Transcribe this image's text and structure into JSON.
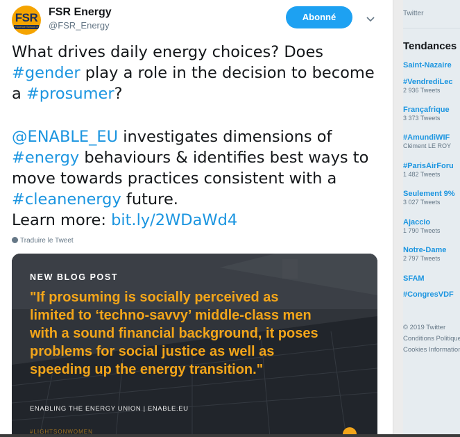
{
  "tweet": {
    "author_name": "FSR Energy",
    "author_handle": "@FSR_Energy",
    "avatar_text": "FSR",
    "avatar_subtext": "Florence School of Regulation",
    "follow_label": "Abonné",
    "paragraph1": [
      {
        "text": "What drives daily energy choices? Does ",
        "link": false
      },
      {
        "text": "#gender",
        "link": true
      },
      {
        "text": " play a role in the decision to become a ",
        "link": false
      },
      {
        "text": "#prosumer",
        "link": true
      },
      {
        "text": "?",
        "link": false
      }
    ],
    "paragraph2": [
      {
        "text": "@ENABLE_EU",
        "link": true
      },
      {
        "text": " investigates dimensions of ",
        "link": false
      },
      {
        "text": "#energy",
        "link": true
      },
      {
        "text": " behaviours & identifies best ways to move towards practices consistent with a ",
        "link": false
      },
      {
        "text": "#cleanenergy",
        "link": true
      },
      {
        "text": " future.",
        "link": false
      }
    ],
    "learn_more_label": "Learn more: ",
    "learn_more_link": "bit.ly/2WDaWd4",
    "translate_label": "Traduire le Tweet",
    "card": {
      "kicker": "NEW BLOG POST",
      "quote": "\"If prosuming is socially perceived as limited to ‘techno-savvy’ middle-class men with a sound financial background, it poses problems for social justice as well as speeding up the energy transition.\"",
      "footer": "ENABLING THE ENERGY UNION | ENABLE.EU",
      "bottom_hashtag": "#LIGHTSONWOMEN"
    }
  },
  "sidebar": {
    "header": "Twitter",
    "trends_title": "Tendances",
    "trends": [
      {
        "name": "Saint-Nazaire",
        "sub": ""
      },
      {
        "name": "#VendrediLec",
        "sub": "2 936 Tweets"
      },
      {
        "name": "Françafrique",
        "sub": "3 373 Tweets"
      },
      {
        "name": "#AmundiWIF",
        "sub": "Clément LE ROY"
      },
      {
        "name": "#ParisAirForu",
        "sub": "1 482 Tweets"
      },
      {
        "name": "Seulement 9%",
        "sub": "3 027 Tweets"
      },
      {
        "name": "Ajaccio",
        "sub": "1 790 Tweets"
      },
      {
        "name": "Notre-Dame",
        "sub": "2 797 Tweets"
      },
      {
        "name": "SFAM",
        "sub": ""
      },
      {
        "name": "#CongresVDF",
        "sub": ""
      }
    ],
    "footer_line1": "© 2019 Twitter",
    "footer_line2": "Conditions  Politique",
    "footer_line3": "Cookies  Informations"
  },
  "colors": {
    "link": "#1b95e0",
    "follow_button": "#1da1f2",
    "card_accent": "#f2a51a",
    "avatar_bg": "#f5a400"
  }
}
